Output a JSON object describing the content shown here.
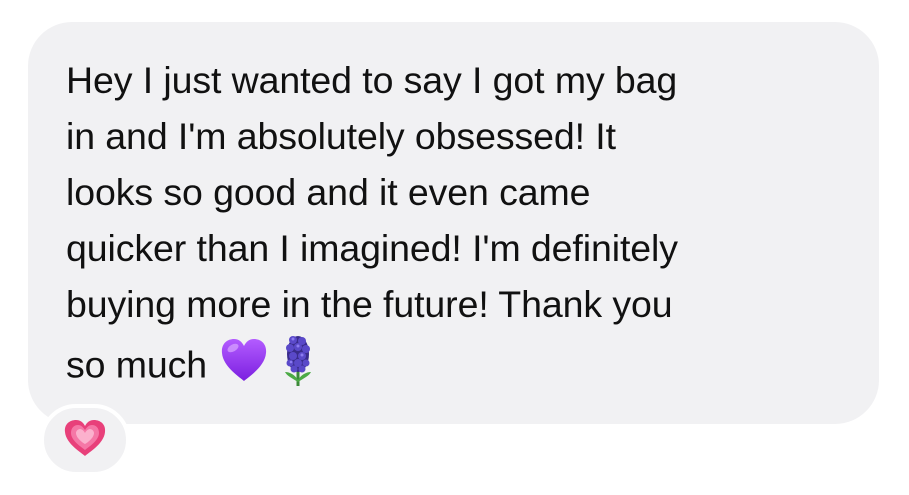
{
  "message": {
    "lines": [
      "Hey I just wanted to say I got my bag",
      "in and I'm absolutely obsessed! It",
      "looks so good and it even came",
      "quicker than I imagined! I'm definitely",
      "buying more in the future! Thank you",
      "so much"
    ],
    "trailing_emojis": [
      "purple-heart",
      "hyacinth"
    ]
  },
  "reaction": {
    "emoji": "growing-heart",
    "color": "#e8407a"
  },
  "colors": {
    "bubble": "#f1f1f3",
    "text": "#111111",
    "purple_heart": "#9b3cf0"
  }
}
